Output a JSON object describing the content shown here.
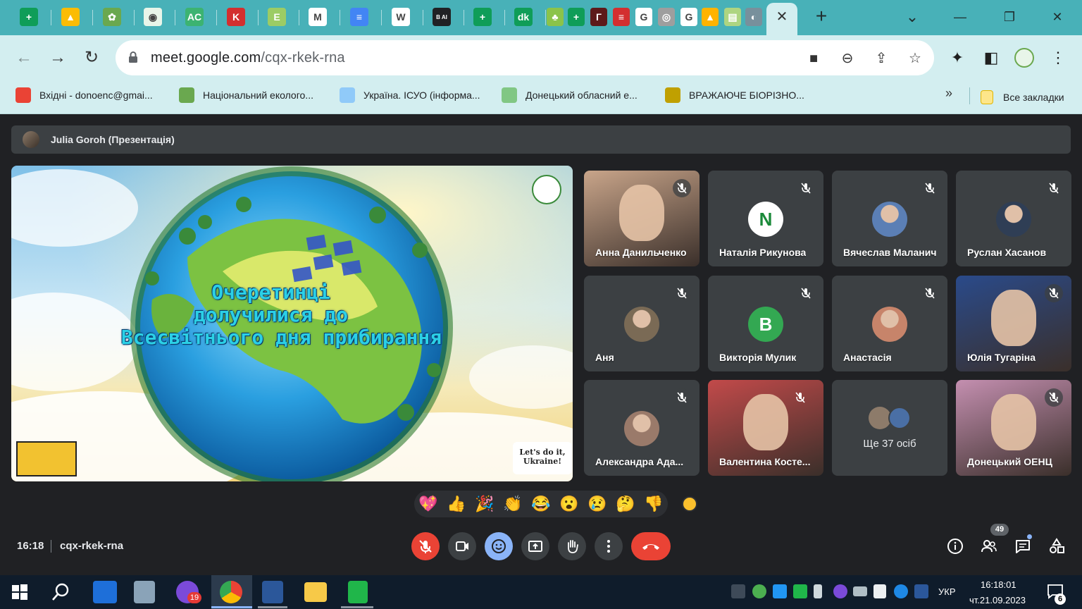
{
  "browser": {
    "tabs": [
      {
        "icon": "sheets-icon",
        "color": "#0f9d58",
        "glyph": "+"
      },
      {
        "icon": "drive-icon",
        "color": "#fbbc04",
        "glyph": "▲"
      },
      {
        "icon": "ecology-icon",
        "color": "#6aa84f",
        "glyph": "✿"
      },
      {
        "icon": "emblem-icon",
        "color": "#e8f5e9",
        "glyph": "◉"
      },
      {
        "icon": "ac-icon",
        "color": "#3cb371",
        "glyph": "AC"
      },
      {
        "icon": "k-icon",
        "color": "#d32f2f",
        "glyph": "K"
      },
      {
        "icon": "e-icon",
        "color": "#9ccc65",
        "glyph": "E"
      },
      {
        "icon": "gmail-icon",
        "color": "#ffffff",
        "glyph": "M"
      },
      {
        "icon": "docs-icon",
        "color": "#4285f4",
        "glyph": "≡"
      },
      {
        "icon": "wikipedia-icon",
        "color": "#ffffff",
        "glyph": "W"
      },
      {
        "icon": "ai-icon",
        "color": "#202124",
        "glyph": "B AI"
      },
      {
        "icon": "sheets-icon-2",
        "color": "#0f9d58",
        "glyph": "+"
      },
      {
        "icon": "dk-icon",
        "color": "#0f9d58",
        "glyph": "dk"
      },
      {
        "icon": "leaf-icon",
        "color": "#8bc34a",
        "glyph": "♣"
      },
      {
        "icon": "sheets-icon-3",
        "color": "#0f9d58",
        "glyph": "+"
      },
      {
        "icon": "g-dark-icon",
        "color": "#5d1a1a",
        "glyph": "Г"
      },
      {
        "icon": "flag-icon",
        "color": "#d32f2f",
        "glyph": "≡"
      },
      {
        "icon": "google-icon",
        "color": "#ffffff",
        "glyph": "G"
      },
      {
        "icon": "chrome-icon",
        "color": "#9e9e9e",
        "glyph": "◎"
      },
      {
        "icon": "google-icon-2",
        "color": "#ffffff",
        "glyph": "G"
      },
      {
        "icon": "bell-icon",
        "color": "#ffb300",
        "glyph": "▲"
      },
      {
        "icon": "notes-icon",
        "color": "#aed581",
        "glyph": "▤"
      },
      {
        "icon": "globe-icon",
        "color": "#78909c",
        "glyph": "◐"
      }
    ],
    "active_tab_close": "✕",
    "new_tab": "+",
    "window": {
      "minimize": "—",
      "restore": "❐",
      "close": "✕",
      "tab_search": "⌄"
    },
    "url_host": "meet.google.com",
    "url_path": "/cqx-rkek-rna",
    "bookmarks": [
      {
        "label": "Вхідні - donoenc@gmai...",
        "icon": "gmail-icon",
        "color": "#ea4335"
      },
      {
        "label": "Національний еколого...",
        "icon": "ecology-icon",
        "color": "#6aa84f"
      },
      {
        "label": "Україна. ІСУО (інформа...",
        "icon": "isuo-icon",
        "color": "#90caf9"
      },
      {
        "label": "Донецький обласний е...",
        "icon": "emblem-icon",
        "color": "#81c784"
      },
      {
        "label": "ВРАЖАЮЧЕ БІОРІЗНО...",
        "icon": "bio-icon",
        "color": "#c0a000"
      }
    ],
    "bookmarks_more": "»",
    "all_bookmarks": "Все закладки"
  },
  "meet": {
    "presenter": "Julia Goroh (Презентація)",
    "slide_title_lines": [
      "Очеретинці",
      "долучилися до",
      "Всесвітнього дня прибирання"
    ],
    "slide_badge": "Let's do it, Ukraine!",
    "participants": [
      {
        "name": "Анна Данильченко",
        "type": "video",
        "bg": "#c9a58a"
      },
      {
        "name": "Наталія Рикунова",
        "type": "letter",
        "letter": "N",
        "bg": "#ffffff",
        "fg": "#1b8a3a"
      },
      {
        "name": "Вячеслав Маланич",
        "type": "photo",
        "bg": "#5b7fb5"
      },
      {
        "name": "Руслан Хасанов",
        "type": "photo",
        "bg": "#2f3e55"
      },
      {
        "name": "Аня",
        "type": "photo",
        "bg": "#7a6a55"
      },
      {
        "name": "Викторія Мулик",
        "type": "letter",
        "letter": "B",
        "bg": "#33a852",
        "fg": "#ffffff"
      },
      {
        "name": "Анастасія",
        "type": "photo",
        "bg": "#c7846a"
      },
      {
        "name": "Юлія Тугаріна",
        "type": "video",
        "bg": "#2a4a8a"
      },
      {
        "name": "Александра Ада...",
        "type": "photo",
        "bg": "#9a7a6a"
      },
      {
        "name": "Валентина Косте...",
        "type": "video",
        "bg": "#c24a4a"
      },
      {
        "name": "Ще 37 осіб",
        "type": "more"
      },
      {
        "name": "Донецький ОЕНЦ",
        "type": "video",
        "bg": "#c48fb0"
      }
    ],
    "reactions": [
      "💖",
      "👍",
      "🎉",
      "👏",
      "😂",
      "😮",
      "😢",
      "🤔",
      "👎"
    ],
    "time": "16:18",
    "code": "cqx-rkek-rna",
    "people_count": "49"
  },
  "taskbar": {
    "viber_badge": "19",
    "lang": "УКР",
    "time": "16:18:01",
    "date": "чт.21.09.2023",
    "notif_count": "6"
  }
}
